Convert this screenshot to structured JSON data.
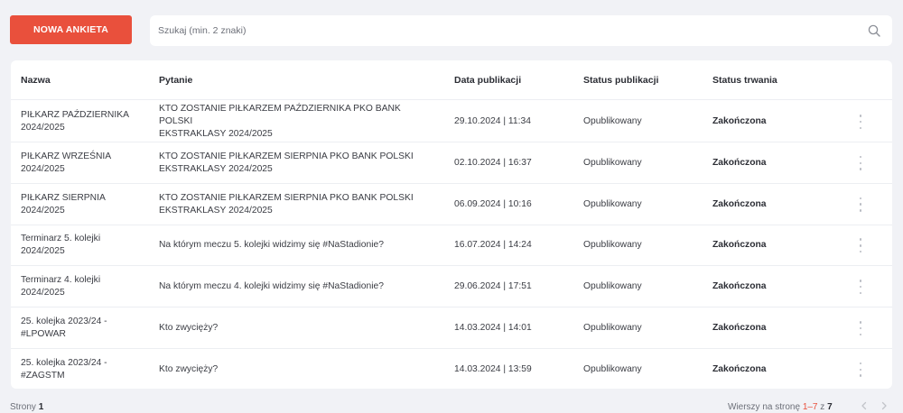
{
  "toolbar": {
    "new_button_label": "NOWA ANKIETA",
    "search_placeholder": "Szukaj (min. 2 znaki)",
    "search_icon": "search-icon"
  },
  "table": {
    "columns": [
      "Nazwa",
      "Pytanie",
      "Data publikacji",
      "Status publikacji",
      "Status trwania"
    ],
    "rows": [
      {
        "name": [
          "PIŁKARZ PAŹDZIERNIKA",
          "2024/2025"
        ],
        "question": [
          "KTO ZOSTANIE PIŁKARZEM PAŹDZIERNIKA PKO BANK POLSKI",
          "EKSTRAKLASY 2024/2025"
        ],
        "date": "29.10.2024 | 11:34",
        "pub_status": "Opublikowany",
        "duration_status": "Zakończona"
      },
      {
        "name": [
          "PIŁKARZ WRZEŚNIA",
          "2024/2025"
        ],
        "question": [
          "KTO ZOSTANIE PIŁKARZEM SIERPNIA PKO BANK POLSKI",
          "EKSTRAKLASY 2024/2025"
        ],
        "date": "02.10.2024 | 16:37",
        "pub_status": "Opublikowany",
        "duration_status": "Zakończona"
      },
      {
        "name": [
          "PIŁKARZ SIERPNIA",
          "2024/2025"
        ],
        "question": [
          "KTO ZOSTANIE PIŁKARZEM SIERPNIA PKO BANK POLSKI",
          "EKSTRAKLASY 2024/2025"
        ],
        "date": "06.09.2024 | 10:16",
        "pub_status": "Opublikowany",
        "duration_status": "Zakończona"
      },
      {
        "name": [
          "Terminarz 5. kolejki",
          "2024/2025"
        ],
        "question": [
          "Na którym meczu 5. kolejki widzimy się #NaStadionie?"
        ],
        "date": "16.07.2024 | 14:24",
        "pub_status": "Opublikowany",
        "duration_status": "Zakończona"
      },
      {
        "name": [
          "Terminarz 4. kolejki",
          "2024/2025"
        ],
        "question": [
          "Na którym meczu 4. kolejki widzimy się #NaStadionie?"
        ],
        "date": "29.06.2024 | 17:51",
        "pub_status": "Opublikowany",
        "duration_status": "Zakończona"
      },
      {
        "name": [
          "25. kolejka 2023/24 -",
          "#LPOWAR"
        ],
        "question": [
          "Kto zwycięży?"
        ],
        "date": "14.03.2024 | 14:01",
        "pub_status": "Opublikowany",
        "duration_status": "Zakończona"
      },
      {
        "name": [
          "25. kolejka 2023/24 -",
          "#ZAGSTM"
        ],
        "question": [
          "Kto zwycięży?"
        ],
        "date": "14.03.2024 | 13:59",
        "pub_status": "Opublikowany",
        "duration_status": "Zakończona"
      }
    ]
  },
  "footer": {
    "pages_label": "Strony",
    "pages_value": "1",
    "rows_per_page_label": "Wierszy na stronę",
    "range": "1–7",
    "of_label": "z",
    "total": "7",
    "prev_icon": "chevron-left-icon",
    "next_icon": "chevron-right-icon"
  },
  "colors": {
    "accent": "#e9503c",
    "background": "#f1f2f6",
    "card": "#ffffff"
  }
}
